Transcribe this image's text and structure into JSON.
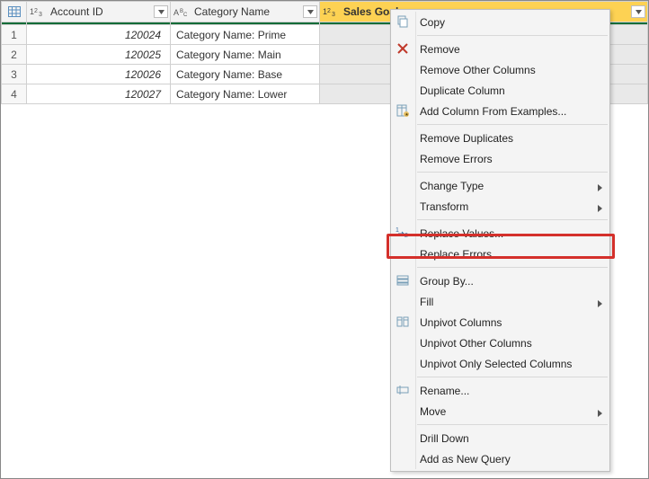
{
  "columns": {
    "rownum_icon": "table-icon",
    "account_id": {
      "type_icon": "1²₃",
      "label": "Account ID"
    },
    "category_name": {
      "type_icon": "AᴮC",
      "label": "Category Name"
    },
    "sales_goal": {
      "type_icon": "1²₃",
      "label": "Sales Goal"
    }
  },
  "rows": [
    {
      "n": "1",
      "account_id": "120024",
      "category_name": "Category Name: Prime"
    },
    {
      "n": "2",
      "account_id": "120025",
      "category_name": "Category Name: Main"
    },
    {
      "n": "3",
      "account_id": "120026",
      "category_name": "Category Name: Base"
    },
    {
      "n": "4",
      "account_id": "120027",
      "category_name": "Category Name: Lower"
    }
  ],
  "menu": {
    "copy": "Copy",
    "remove": "Remove",
    "remove_other": "Remove Other Columns",
    "duplicate": "Duplicate Column",
    "add_from_examples": "Add Column From Examples...",
    "remove_duplicates": "Remove Duplicates",
    "remove_errors": "Remove Errors",
    "change_type": "Change Type",
    "transform": "Transform",
    "replace_values": "Replace Values...",
    "replace_errors": "Replace Errors...",
    "group_by": "Group By...",
    "fill": "Fill",
    "unpivot": "Unpivot Columns",
    "unpivot_other": "Unpivot Other Columns",
    "unpivot_selected": "Unpivot Only Selected Columns",
    "rename": "Rename...",
    "move": "Move",
    "drill_down": "Drill Down",
    "add_as_new_query": "Add as New Query"
  }
}
